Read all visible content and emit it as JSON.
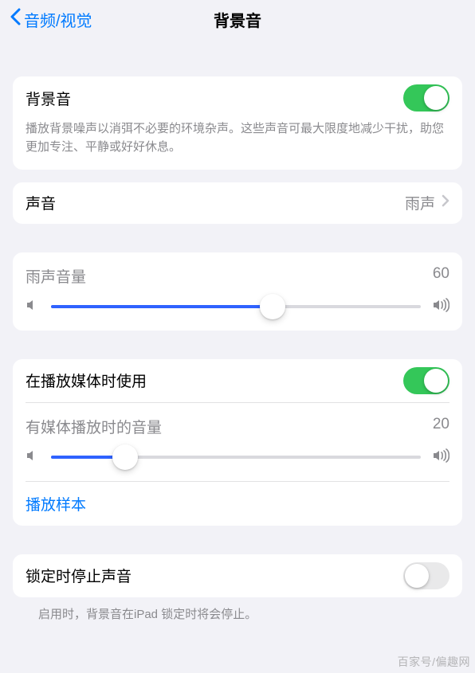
{
  "nav": {
    "back_label": "音频/视觉",
    "title": "背景音"
  },
  "main_toggle": {
    "label": "背景音",
    "on": true,
    "description": "播放背景噪声以消弭不必要的环境杂声。这些声音可最大限度地减少干扰，助您更加专注、平静或好好休息。"
  },
  "sound_row": {
    "label": "声音",
    "value": "雨声"
  },
  "volume1": {
    "label": "雨声音量",
    "value": "60",
    "percent": 60
  },
  "media": {
    "toggle_label": "在播放媒体时使用",
    "toggle_on": true,
    "volume_label": "有媒体播放时的音量",
    "volume_value": "20",
    "volume_percent": 20,
    "sample_link": "播放样本"
  },
  "lock": {
    "label": "锁定时停止声音",
    "on": false,
    "description": "启用时，背景音在iPad 锁定时将会停止。"
  },
  "watermark": "百家号/偏趣网"
}
